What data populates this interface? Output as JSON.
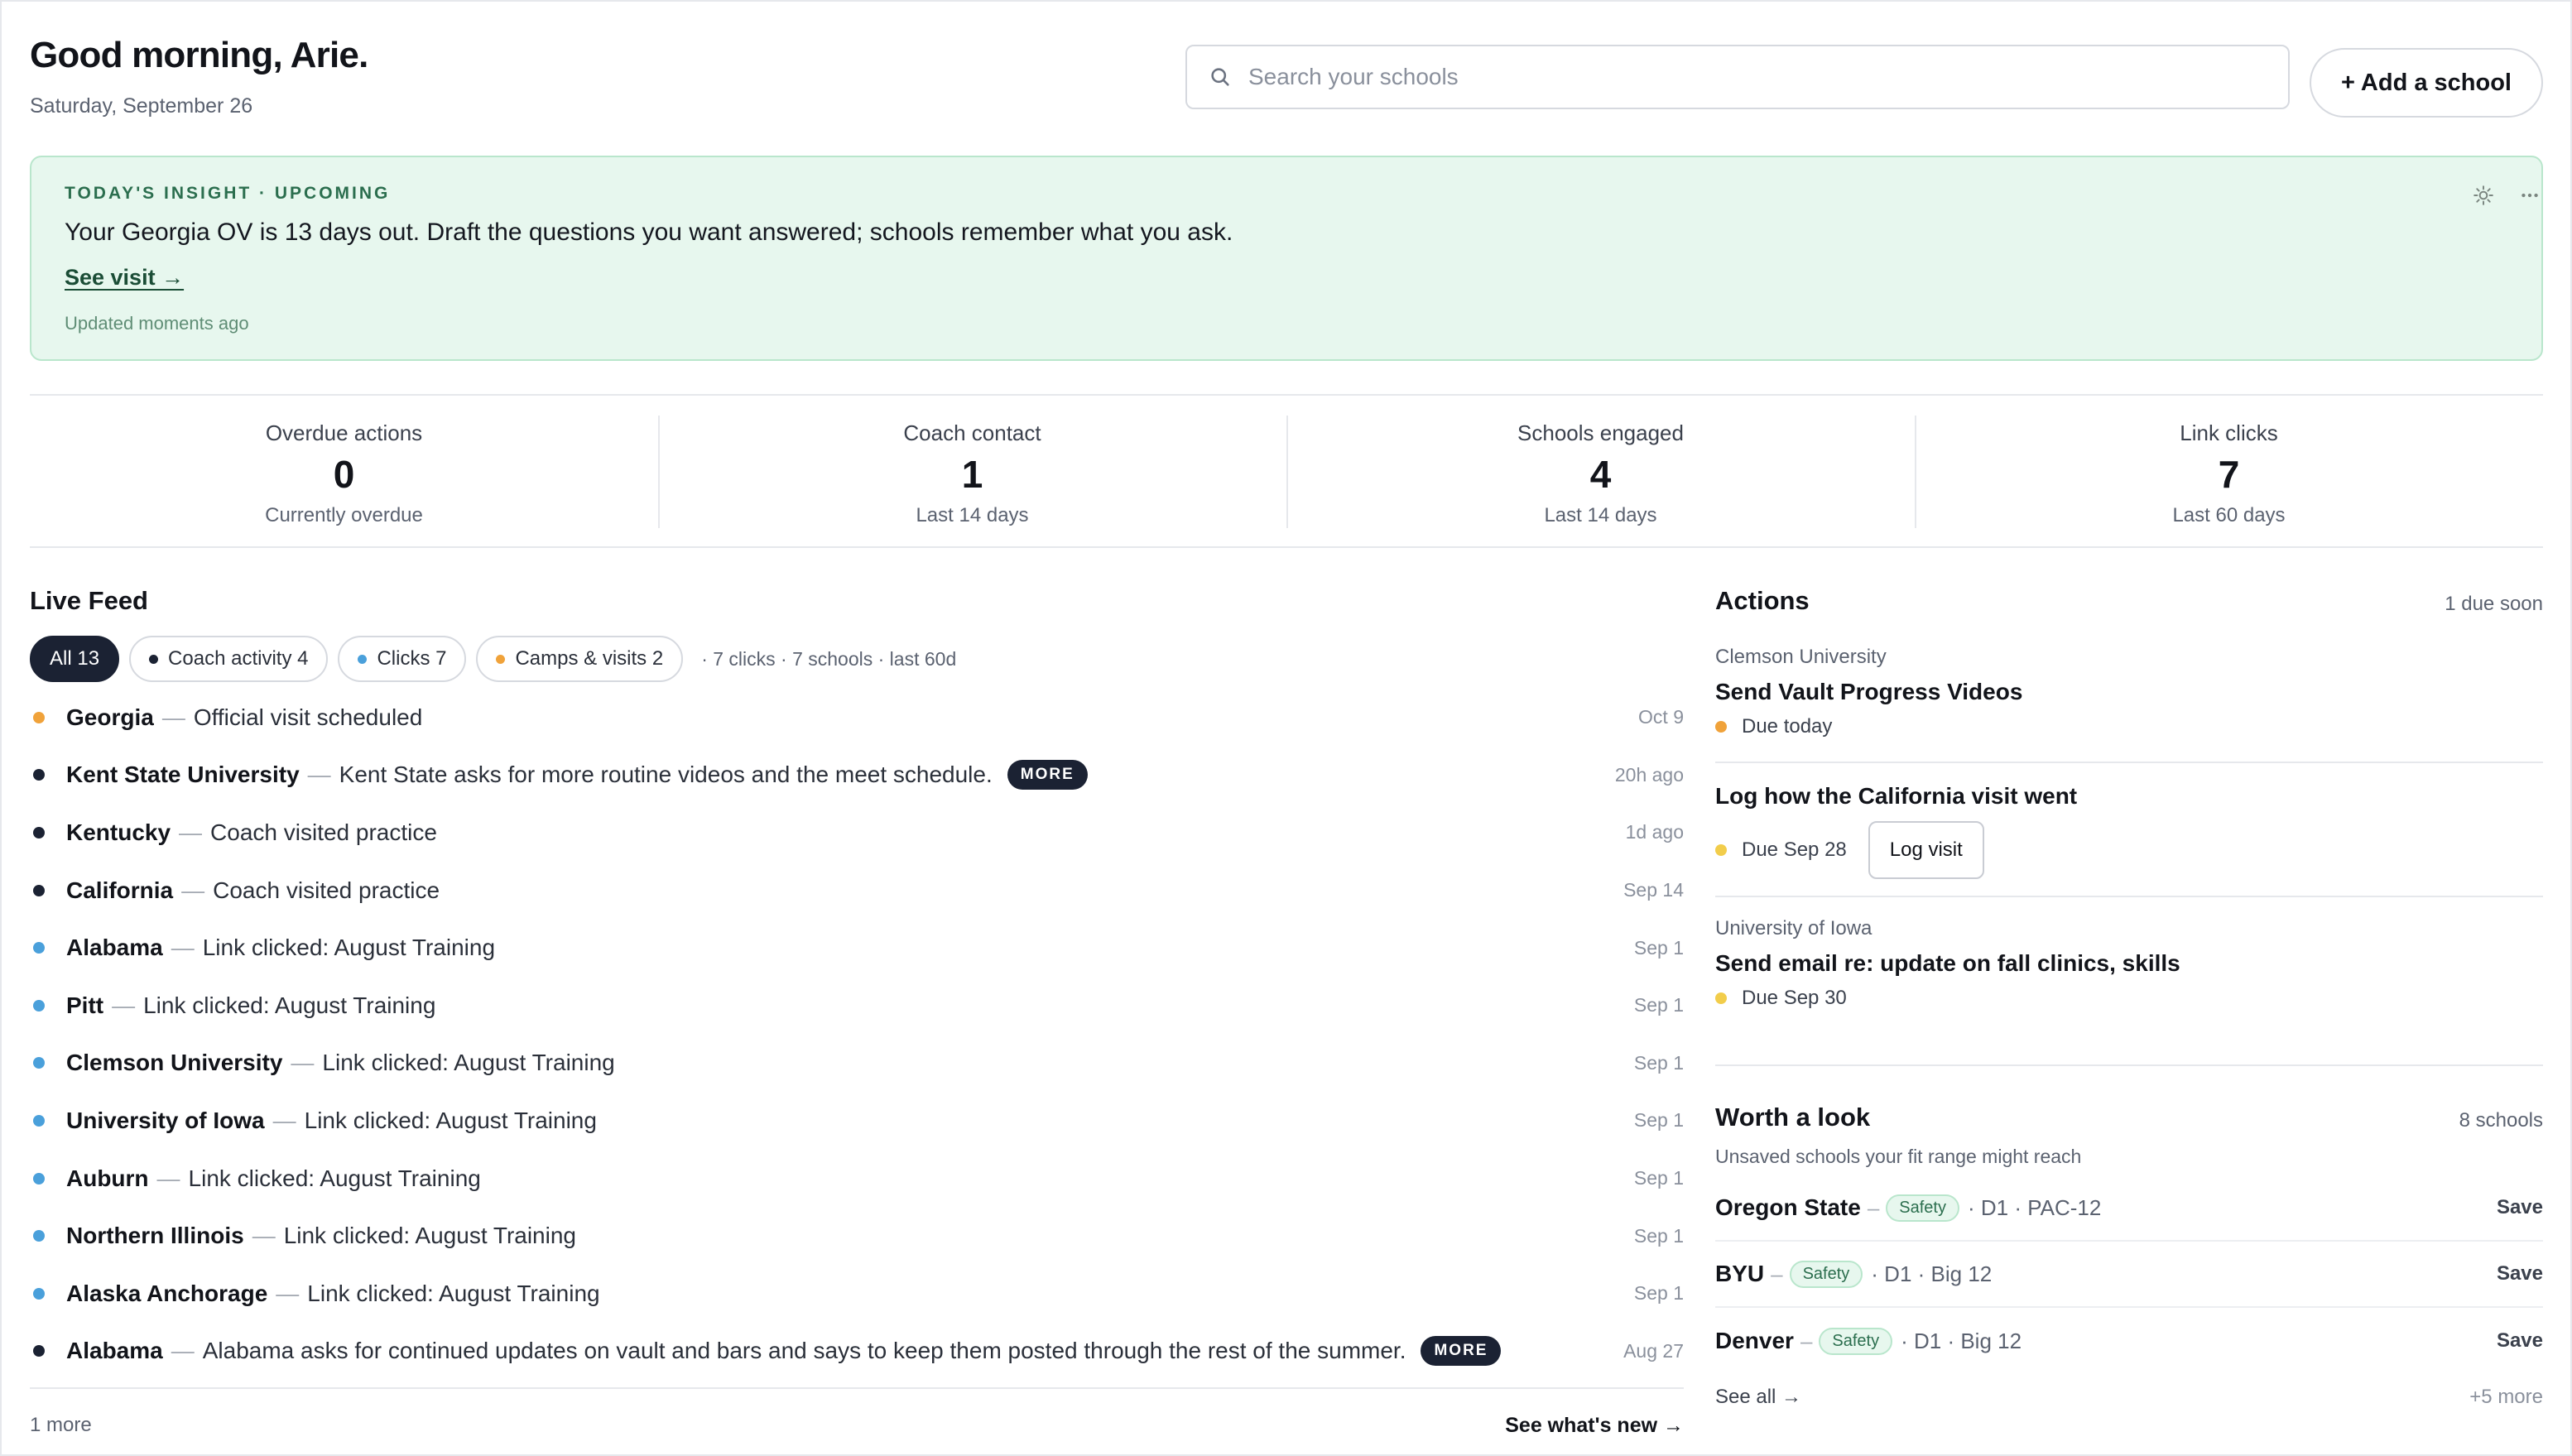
{
  "header": {
    "greeting": "Good morning, Arie.",
    "date": "Saturday, September 26",
    "search_placeholder": "Search your schools",
    "add_school_label": "+ Add a school"
  },
  "insight": {
    "eyebrow": "TODAY'S INSIGHT · UPCOMING",
    "text": "Your Georgia OV is 13 days out. Draft the questions you want answered; schools remember what you ask.",
    "link_label": "See visit →",
    "updated": "Updated moments ago",
    "icons": [
      "sun-icon",
      "more-icon"
    ]
  },
  "stats": [
    {
      "label": "Overdue actions",
      "value": "0",
      "sub": "Currently overdue"
    },
    {
      "label": "Coach contact",
      "value": "1",
      "sub": "Last 14 days"
    },
    {
      "label": "Schools engaged",
      "value": "4",
      "sub": "Last 14 days"
    },
    {
      "label": "Link clicks",
      "value": "7",
      "sub": "Last 60 days"
    }
  ],
  "feed": {
    "title": "Live Feed",
    "filters": [
      {
        "label": "All 13",
        "active": true,
        "dot": ""
      },
      {
        "label": "Coach activity 4",
        "active": false,
        "dot": "#1b2233"
      },
      {
        "label": "Clicks 7",
        "active": false,
        "dot": "#4aa0db"
      },
      {
        "label": "Camps & visits 2",
        "active": false,
        "dot": "#f0a23a"
      }
    ],
    "summary": "· 7 clicks · 7 schools · last 60d",
    "items": [
      {
        "school": "Georgia",
        "desc": "Official visit scheduled",
        "time": "Oct 9",
        "dot": "#f0a23a",
        "more": ""
      },
      {
        "school": "Kent State University",
        "desc": "Kent State asks for more routine videos and the meet schedule.",
        "time": "20h ago",
        "dot": "#1b2233",
        "more": "MORE"
      },
      {
        "school": "Kentucky",
        "desc": "Coach visited practice",
        "time": "1d ago",
        "dot": "#1b2233",
        "more": ""
      },
      {
        "school": "California",
        "desc": "Coach visited practice",
        "time": "Sep 14",
        "dot": "#1b2233",
        "more": ""
      },
      {
        "school": "Alabama",
        "desc": "Link clicked: August Training",
        "time": "Sep 1",
        "dot": "#4aa0db",
        "more": ""
      },
      {
        "school": "Pitt",
        "desc": "Link clicked: August Training",
        "time": "Sep 1",
        "dot": "#4aa0db",
        "more": ""
      },
      {
        "school": "Clemson University",
        "desc": "Link clicked: August Training",
        "time": "Sep 1",
        "dot": "#4aa0db",
        "more": ""
      },
      {
        "school": "University of Iowa",
        "desc": "Link clicked: August Training",
        "time": "Sep 1",
        "dot": "#4aa0db",
        "more": ""
      },
      {
        "school": "Auburn",
        "desc": "Link clicked: August Training",
        "time": "Sep 1",
        "dot": "#4aa0db",
        "more": ""
      },
      {
        "school": "Northern Illinois",
        "desc": "Link clicked: August Training",
        "time": "Sep 1",
        "dot": "#4aa0db",
        "more": ""
      },
      {
        "school": "Alaska Anchorage",
        "desc": "Link clicked: August Training",
        "time": "Sep 1",
        "dot": "#4aa0db",
        "more": ""
      },
      {
        "school": "Alabama",
        "desc": "Alabama asks for continued updates on vault and bars and says to keep them posted through the rest of the summer.",
        "time": "Aug 27",
        "dot": "#1b2233",
        "more": "MORE"
      }
    ],
    "footer_more": "1 more",
    "footer_link": "See what's new →"
  },
  "actions": {
    "title": "Actions",
    "due_summary": "1 due soon",
    "items": [
      {
        "org": "Clemson University",
        "name": "Send Vault Progress Videos",
        "due": "Due today",
        "dot": "#f0a23a",
        "button": ""
      },
      {
        "org": "",
        "name": "Log how the California visit went",
        "due": "Due Sep 28",
        "dot": "#f2cd4b",
        "button": "Log visit"
      },
      {
        "org": "University of Iowa",
        "name": "Send email re: update on fall clinics, skills",
        "due": "Due Sep 30",
        "dot": "#f2cd4b",
        "button": ""
      }
    ]
  },
  "worth": {
    "title": "Worth a look",
    "count": "8 schools",
    "subtitle": "Unsaved schools your fit range might reach",
    "schools": [
      {
        "name": "Oregon State",
        "badge": "Safety",
        "meta": "· D1 · PAC-12",
        "save": "Save"
      },
      {
        "name": "BYU",
        "badge": "Safety",
        "meta": "· D1 · Big 12",
        "save": "Save"
      },
      {
        "name": "Denver",
        "badge": "Safety",
        "meta": "· D1 · Big 12",
        "save": "Save"
      }
    ],
    "see_all": "See all →",
    "more": "+5 more"
  }
}
